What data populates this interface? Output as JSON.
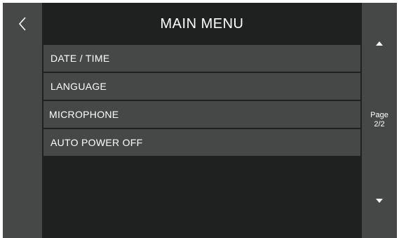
{
  "header": {
    "title": "MAIN MENU"
  },
  "navigation": {
    "back_icon": "chevron-left-icon",
    "page_up_icon": "triangle-up-icon",
    "page_down_icon": "triangle-down-icon"
  },
  "menu": {
    "items": [
      {
        "label": "DATE / TIME"
      },
      {
        "label": "LANGUAGE"
      },
      {
        "label": "MICROPHONE"
      },
      {
        "label": "AUTO POWER OFF"
      }
    ]
  },
  "pagination": {
    "label": "Page",
    "value": "2/2"
  },
  "colors": {
    "background": "#1f2020",
    "panel": "#464747",
    "text": "#ffffff"
  }
}
